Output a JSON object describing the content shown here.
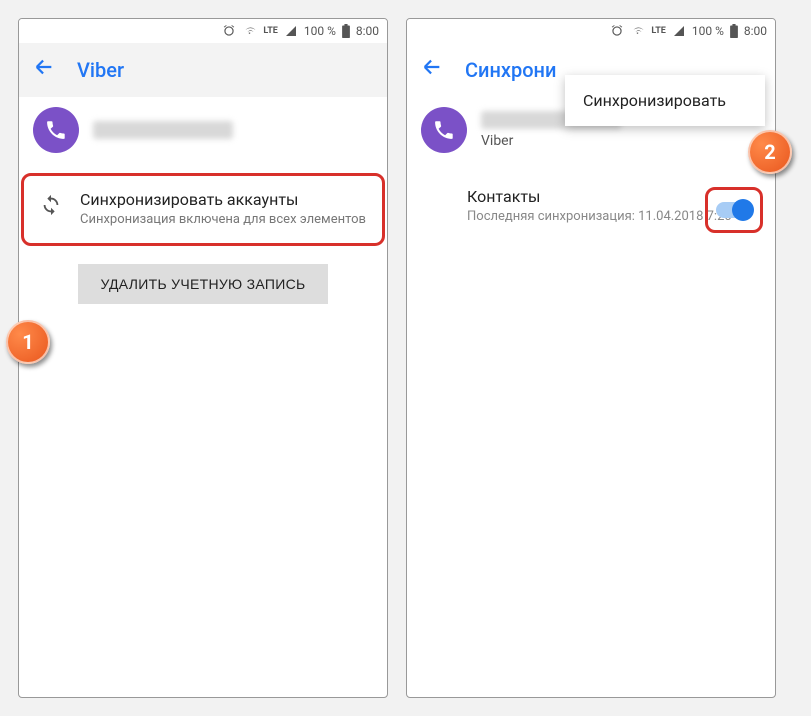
{
  "status": {
    "battery": "100 %",
    "time": "8:00",
    "network": "LTE"
  },
  "screen1": {
    "title": "Viber",
    "sync_title": "Синхронизировать аккаунты",
    "sync_sub": "Синхронизация включена для всех элементов",
    "delete_btn": "УДАЛИТЬ УЧЕТНУЮ ЗАПИСЬ"
  },
  "screen2": {
    "title": "Синхрони",
    "popup": "Синхронизировать",
    "account_sub": "Viber",
    "contacts_title": "Контакты",
    "contacts_sub": "Последняя синхронизация: 11.04.2018 7:20"
  },
  "badges": {
    "one": "1",
    "two": "2"
  }
}
